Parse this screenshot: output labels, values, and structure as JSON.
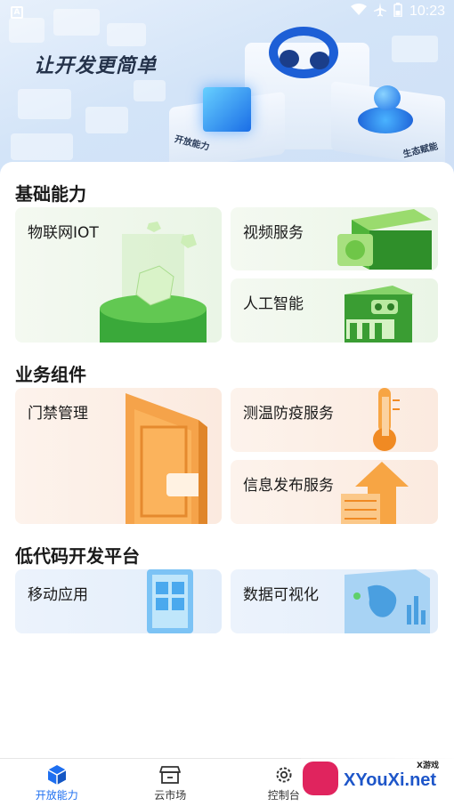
{
  "status_bar": {
    "time": "10:23",
    "icons": [
      "wifi-icon",
      "airplane-icon",
      "battery-icon"
    ]
  },
  "hero": {
    "title": "让开发更简单",
    "label_left": "开放能力",
    "label_right": "生态赋能"
  },
  "sections": [
    {
      "title": "基础能力",
      "cards": [
        {
          "label": "物联网IOT",
          "theme": "green"
        },
        {
          "label": "视频服务",
          "theme": "green"
        },
        {
          "label": "人工智能",
          "theme": "green"
        }
      ]
    },
    {
      "title": "业务组件",
      "cards": [
        {
          "label": "门禁管理",
          "theme": "orange"
        },
        {
          "label": "测温防疫服务",
          "theme": "orange"
        },
        {
          "label": "信息发布服务",
          "theme": "orange"
        }
      ]
    },
    {
      "title": "低代码开发平台",
      "cards": [
        {
          "label": "移动应用",
          "theme": "blue"
        },
        {
          "label": "数据可视化",
          "theme": "blue"
        }
      ]
    }
  ],
  "bottom_nav": {
    "items": [
      {
        "label": "开放能力",
        "icon": "cube-icon",
        "active": true
      },
      {
        "label": "云市场",
        "icon": "store-icon",
        "active": false
      },
      {
        "label": "控制台",
        "icon": "gear-icon",
        "active": false
      }
    ]
  },
  "watermark": {
    "text": "XYouXi.net",
    "small": "X游戏"
  },
  "colors": {
    "accent": "#1e6ff0",
    "green_card": "#eef7ea",
    "orange_card": "#fcefe5",
    "blue_card": "#e7f0fb"
  }
}
